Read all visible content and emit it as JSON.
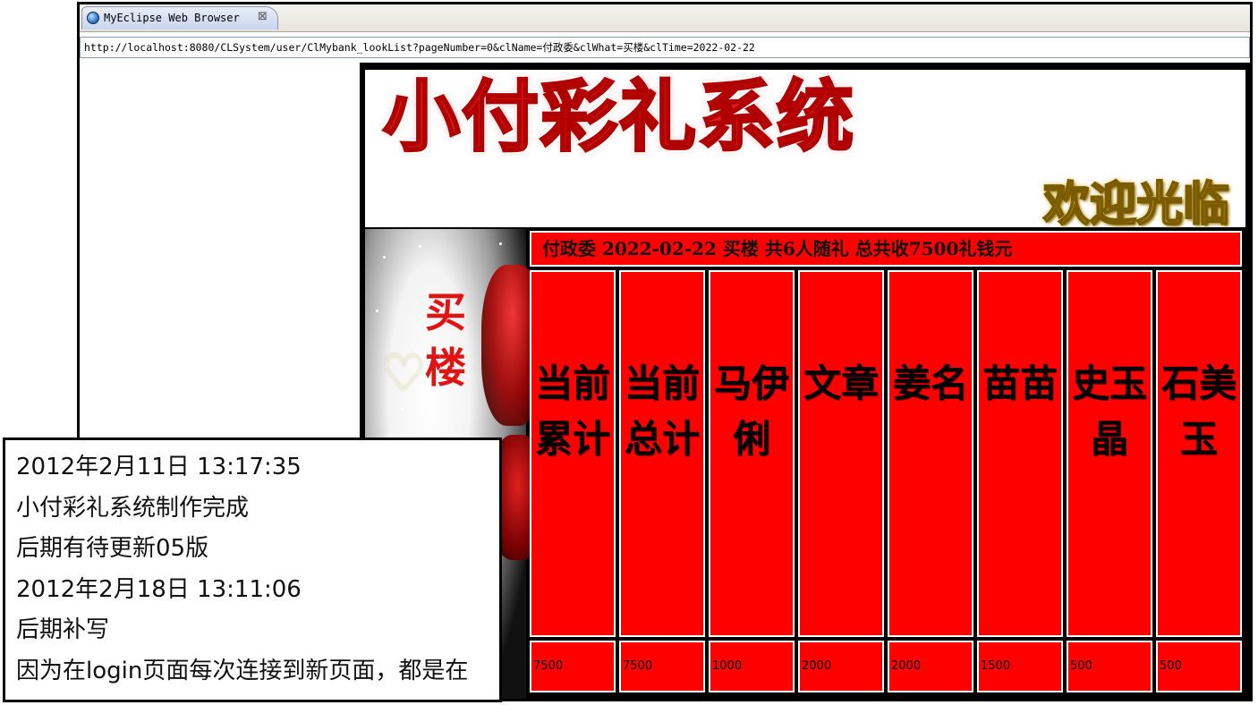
{
  "browser": {
    "tab_title": "MyEclipse Web Browser",
    "close_glyph": "⊠",
    "url": "http://localhost:8080/CLSystem/user/ClMybank_lookList?pageNumber=0&clName=付政委&clWhat=买楼&clTime=2022-02-22"
  },
  "page": {
    "title": "小付彩礼系统",
    "welcome": "欢迎光临",
    "category": "买楼",
    "summary": "付政委  2022-02-22  买楼  共6人随礼  总共收7500礼钱元"
  },
  "columns": [
    {
      "name": "当前累计",
      "amount": "7500"
    },
    {
      "name": "当前总计",
      "amount": "7500"
    },
    {
      "name": "马伊俐",
      "amount": "1000"
    },
    {
      "name": "文章",
      "amount": "2000"
    },
    {
      "name": "姜名",
      "amount": "2000"
    },
    {
      "name": "苗苗",
      "amount": "1500"
    },
    {
      "name": "史玉晶",
      "amount": "500"
    },
    {
      "name": "石美玉",
      "amount": "500"
    }
  ],
  "notes": {
    "lines": [
      "2012年2月11日 13:17:35",
      "小付彩礼系统制作完成",
      "后期有待更新05版",
      "2012年2月18日 13:11:06",
      "后期补写",
      "因为在login页面每次连接到新页面，都是在"
    ]
  },
  "colors": {
    "brand_red": "#ff0000",
    "title_red": "#e21b1b",
    "welcome_gold": "#e8c12e"
  }
}
